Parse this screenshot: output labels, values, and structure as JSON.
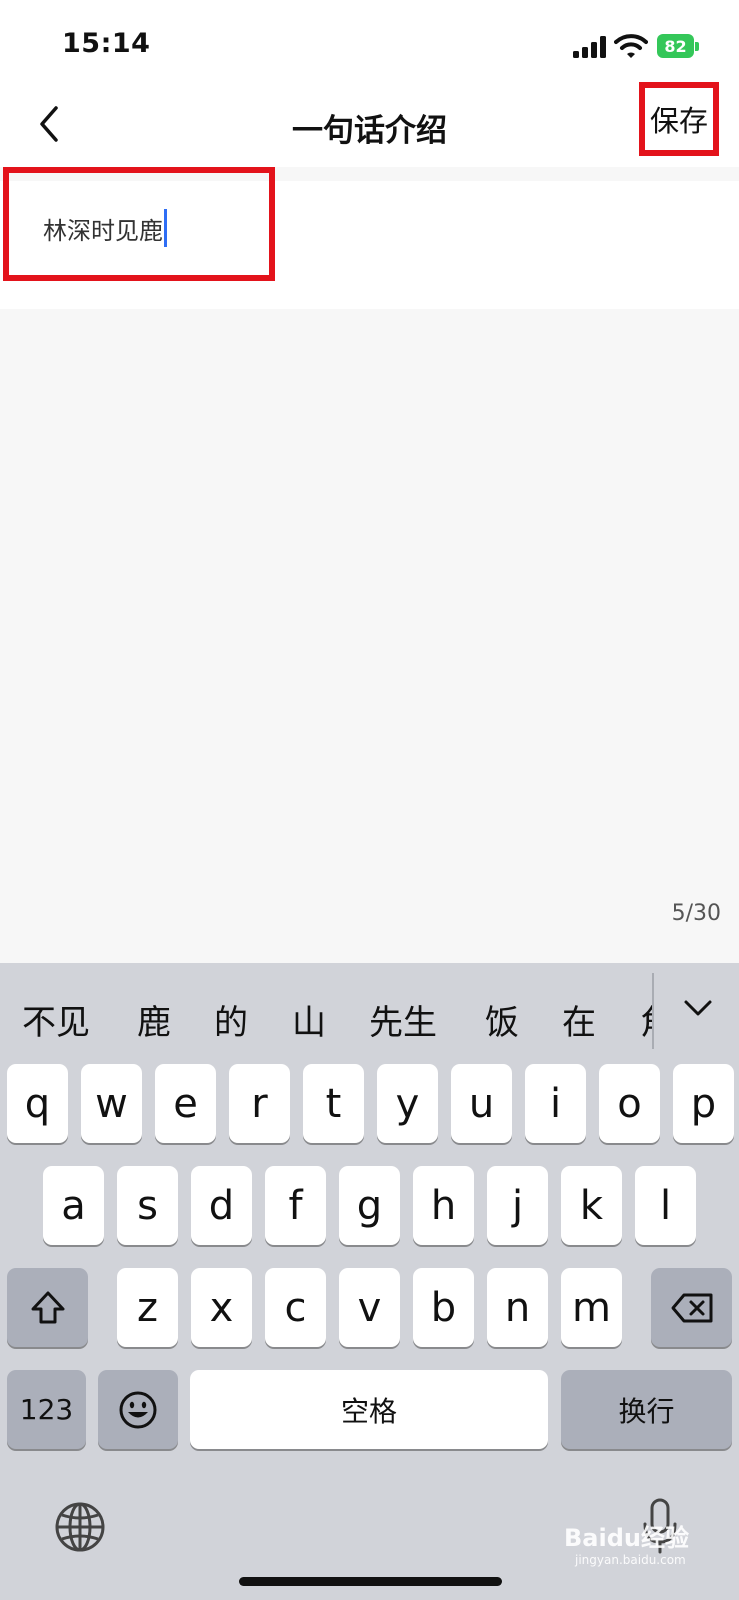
{
  "status": {
    "time": "15:14",
    "battery": "82"
  },
  "nav": {
    "title": "一句话介绍",
    "save_label": "保存"
  },
  "input": {
    "value": "林深时见鹿",
    "counter": "5/30"
  },
  "candidates": [
    "不见",
    "鹿",
    "的",
    "山",
    "先生",
    "饭",
    "在",
    "角"
  ],
  "keys": {
    "row1": [
      "q",
      "w",
      "e",
      "r",
      "t",
      "y",
      "u",
      "i",
      "o",
      "p"
    ],
    "row2": [
      "a",
      "s",
      "d",
      "f",
      "g",
      "h",
      "j",
      "k",
      "l"
    ],
    "row3": [
      "z",
      "x",
      "c",
      "v",
      "b",
      "n",
      "m"
    ],
    "numbers": "123",
    "space": "空格",
    "return": "换行"
  },
  "watermark": {
    "brand": "Baidu经验",
    "url": "jingyan.baidu.com"
  },
  "colors": {
    "highlight": "#e3131b",
    "caret": "#2f6ef5",
    "battery": "#34c759"
  }
}
